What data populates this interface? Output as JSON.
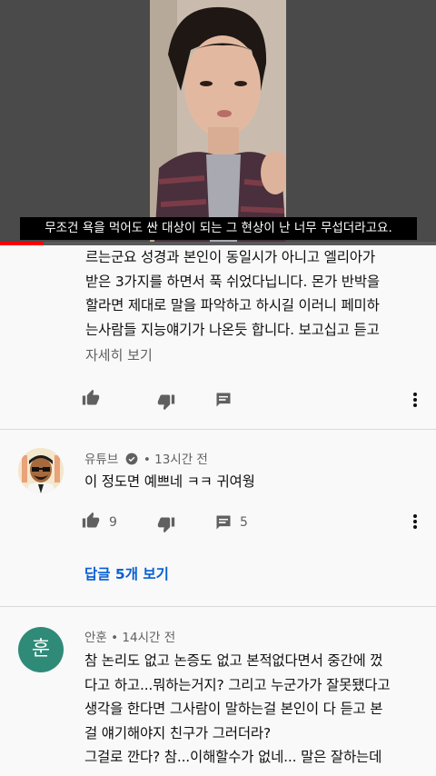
{
  "video": {
    "subtitle": "무조건 욕을 먹어도 싼 대상이 되는 그 현상이 난 너무 무섭더라고요.",
    "progress_fraction": 0.1
  },
  "comment1": {
    "lines": [
      "르는군요 성경과 본인이 동일시가 아니고 엘리아가",
      "받은 3가지를 하면서 푹 쉬었다닙니다. 몬가 반박을",
      "할라면 제대로 말을 파악하고 하시길 이러니 페미하",
      "는사람들 지능얘기가 나온듯 합니다.  보고십고 듣고"
    ],
    "read_more": "자세히 보기"
  },
  "comment2": {
    "author": "유튜브",
    "time": "13시간 전",
    "separator": "•",
    "text": "이 정도면 예쁘네 ㅋㅋ 귀여웡",
    "likes": "9",
    "replies": "5",
    "view_replies": "답글 5개 보기"
  },
  "comment3": {
    "avatar_letter": "훈",
    "author": "안훈",
    "time": "14시간 전",
    "separator": "•",
    "lines": [
      "참 논리도 없고 논증도 없고 본적없다면서 중간에 껐",
      "다고 하고...뭐하는거지? 그리고 누군가가 잘못됐다고",
      "생각을 한다면 그사람이 말하는걸 본인이 다 듣고 본",
      "걸 얘기해야지 친구가 그러더라?",
      "그걸로 깐다? 참...이해할수가 없네... 말은 잘하는데"
    ]
  },
  "colors": {
    "accent_link": "#065fd4",
    "progress": "#ff0000",
    "avatar_teal": "#2f8a78",
    "muted": "#606060"
  },
  "icons": [
    "like-icon",
    "dislike-icon",
    "reply-comment-icon",
    "more-vert-icon",
    "verified-badge-icon"
  ]
}
